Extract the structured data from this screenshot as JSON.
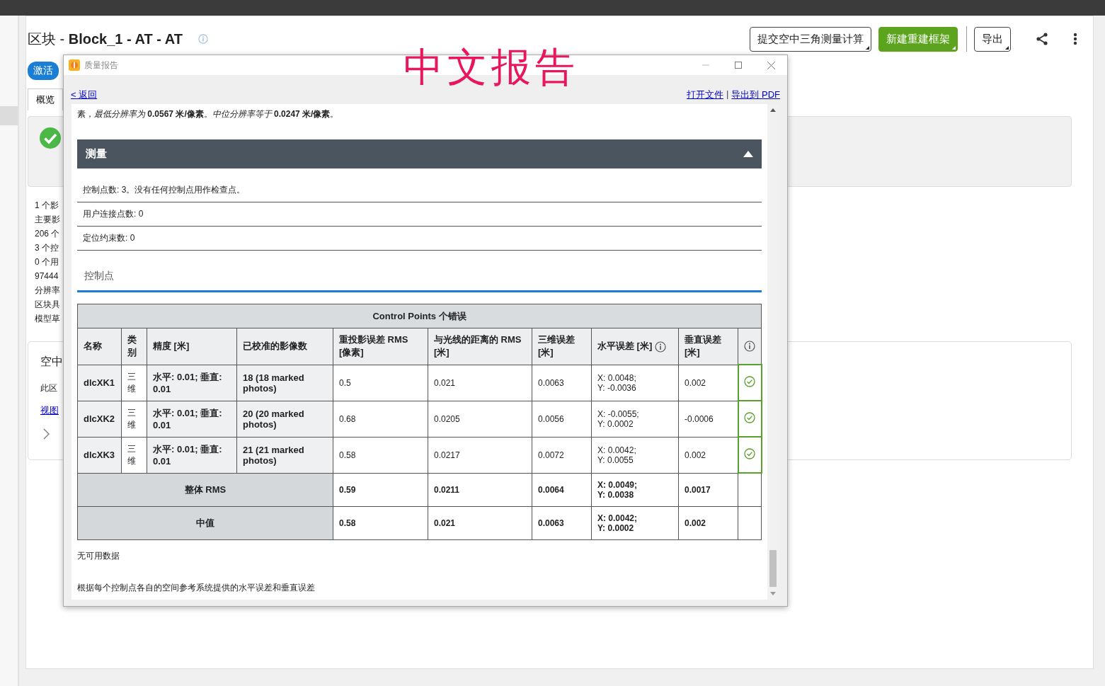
{
  "page": {
    "title": "区块 - **Block_1 - AT - AT**",
    "activate_button": "激活",
    "actions": [
      {
        "label": "提交空中三角测量计算",
        "kind": "outline"
      },
      {
        "label": "新建重建框架",
        "kind": "primary"
      },
      {
        "label": "导出",
        "kind": "outline"
      }
    ],
    "tabs": [
      {
        "label": "概览",
        "selected": true
      }
    ],
    "summary_lines": [
      "1 个影",
      "主要影",
      "206 个",
      "3 个控",
      "0 个用",
      "97444",
      "分辨率",
      "区块具",
      "模型草"
    ],
    "card": {
      "title": "空中",
      "text": "此区",
      "link": "视图"
    }
  },
  "dialog": {
    "title": "质量报告",
    "back_link": "< 返回",
    "links": [
      "打开文件",
      "导出到 PDF"
    ],
    "separator": "|",
    "intro": "素，*最低分辨率为* **0.0567 米/像素**。*中位分辨率等于* **0.0247 米/像素**。",
    "section": {
      "title": "测量",
      "expanded": true,
      "items": [
        "控制点数: 3。没有任何控制点用作检查点。",
        "用户连接点数: 0",
        "定位约束数: 0"
      ]
    },
    "subsection": "控制点",
    "table": {
      "caption": "Control Points 个错误",
      "columns": [
        {
          "label": "名称"
        },
        {
          "label": "类别"
        },
        {
          "label": "精度 [米]"
        },
        {
          "label": "已校准的影像数"
        },
        {
          "label": "重投影误差 RMS [像素]"
        },
        {
          "label": "与光线的距离的 RMS [米]"
        },
        {
          "label": "三维误差 [米]"
        },
        {
          "label": "水平误差 [米]",
          "info": true
        },
        {
          "label": "垂直误差 [米]"
        },
        {
          "info": true
        }
      ],
      "rows": [
        {
          "cells": [
            "dlcXK1",
            "三维",
            "水平: 0.01; 垂直: 0.01",
            "18 (18 marked photos)",
            "0.5",
            "0.021",
            "0.0063",
            "X: 0.0048;\nY: -0.0036",
            "0.002"
          ],
          "ok": true
        },
        {
          "cells": [
            "dlcXK2",
            "三维",
            "水平: 0.01; 垂直: 0.01",
            "20 (20 marked photos)",
            "0.68",
            "0.0205",
            "0.0056",
            "X: -0.0055;\nY: 0.0002",
            "-0.0006"
          ],
          "ok": true
        },
        {
          "cells": [
            "dlcXK3",
            "三维",
            "水平: 0.01; 垂直: 0.01",
            "21 (21 marked photos)",
            "0.58",
            "0.0217",
            "0.0072",
            "X: 0.0042;\nY: 0.0055",
            "0.002"
          ],
          "ok": true
        }
      ],
      "summary": [
        {
          "label": "整体 RMS",
          "cells": [
            "0.59",
            "0.0211",
            "0.0064",
            "X: 0.0049;\nY: 0.0038",
            "0.0017"
          ]
        },
        {
          "label": "中值",
          "cells": [
            "0.58",
            "0.021",
            "0.0063",
            "X: 0.0042;\nY: 0.0002",
            "0.002"
          ]
        }
      ]
    },
    "notes": [
      "无可用数据",
      "根据每个控制点各自的空间参考系统提供的水平误差和垂直误差"
    ]
  },
  "annotation": "中文报告"
}
